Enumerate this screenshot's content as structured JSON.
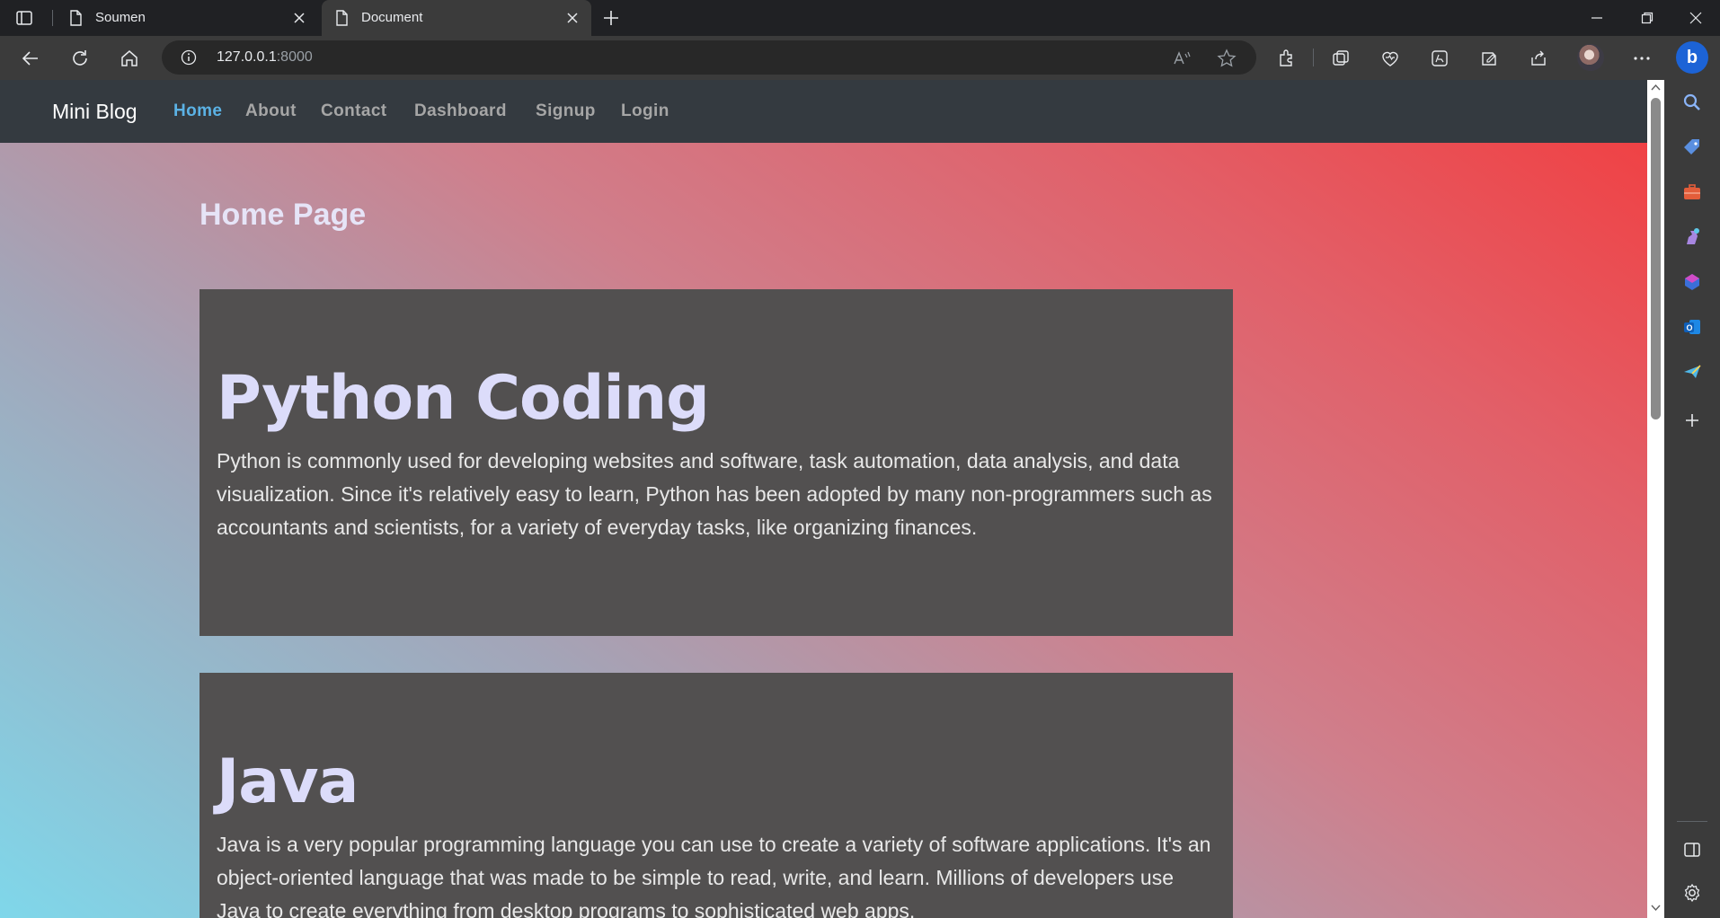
{
  "browser": {
    "tabs": [
      {
        "label": "Soumen",
        "active": false,
        "icon": "page-icon"
      },
      {
        "label": "Document",
        "active": true,
        "icon": "page-icon"
      }
    ],
    "address": {
      "host": "127.0.0.1",
      "port": ":8000"
    },
    "accent": "#1c63d6"
  },
  "site": {
    "brand": "Mini Blog",
    "nav": [
      {
        "label": "Home",
        "active": true
      },
      {
        "label": "About",
        "active": false
      },
      {
        "label": "Contact",
        "active": false
      },
      {
        "label": "Dashboard",
        "active": false
      },
      {
        "label": "Signup",
        "active": false
      },
      {
        "label": "Login",
        "active": false
      }
    ],
    "navbar_color": "#343a40",
    "active_link_color": "#5bb2e5"
  },
  "page": {
    "title": "Home Page",
    "posts": [
      {
        "title": "Python Coding",
        "body": "Python is commonly used for developing websites and software, task automation, data analysis, and data visualization. Since it's relatively easy to learn, Python has been adopted by many non-programmers such as accountants and scientists, for a variety of everyday tasks, like organizing finances."
      },
      {
        "title": "Java",
        "body": "Java is a very popular programming language you can use to create a variety of software applications. It's an object-oriented language that was made to be simple to read, write, and learn. Millions of developers use Java to create everything from desktop programs to sophisticated web apps."
      }
    ],
    "card_color": "#525050"
  }
}
